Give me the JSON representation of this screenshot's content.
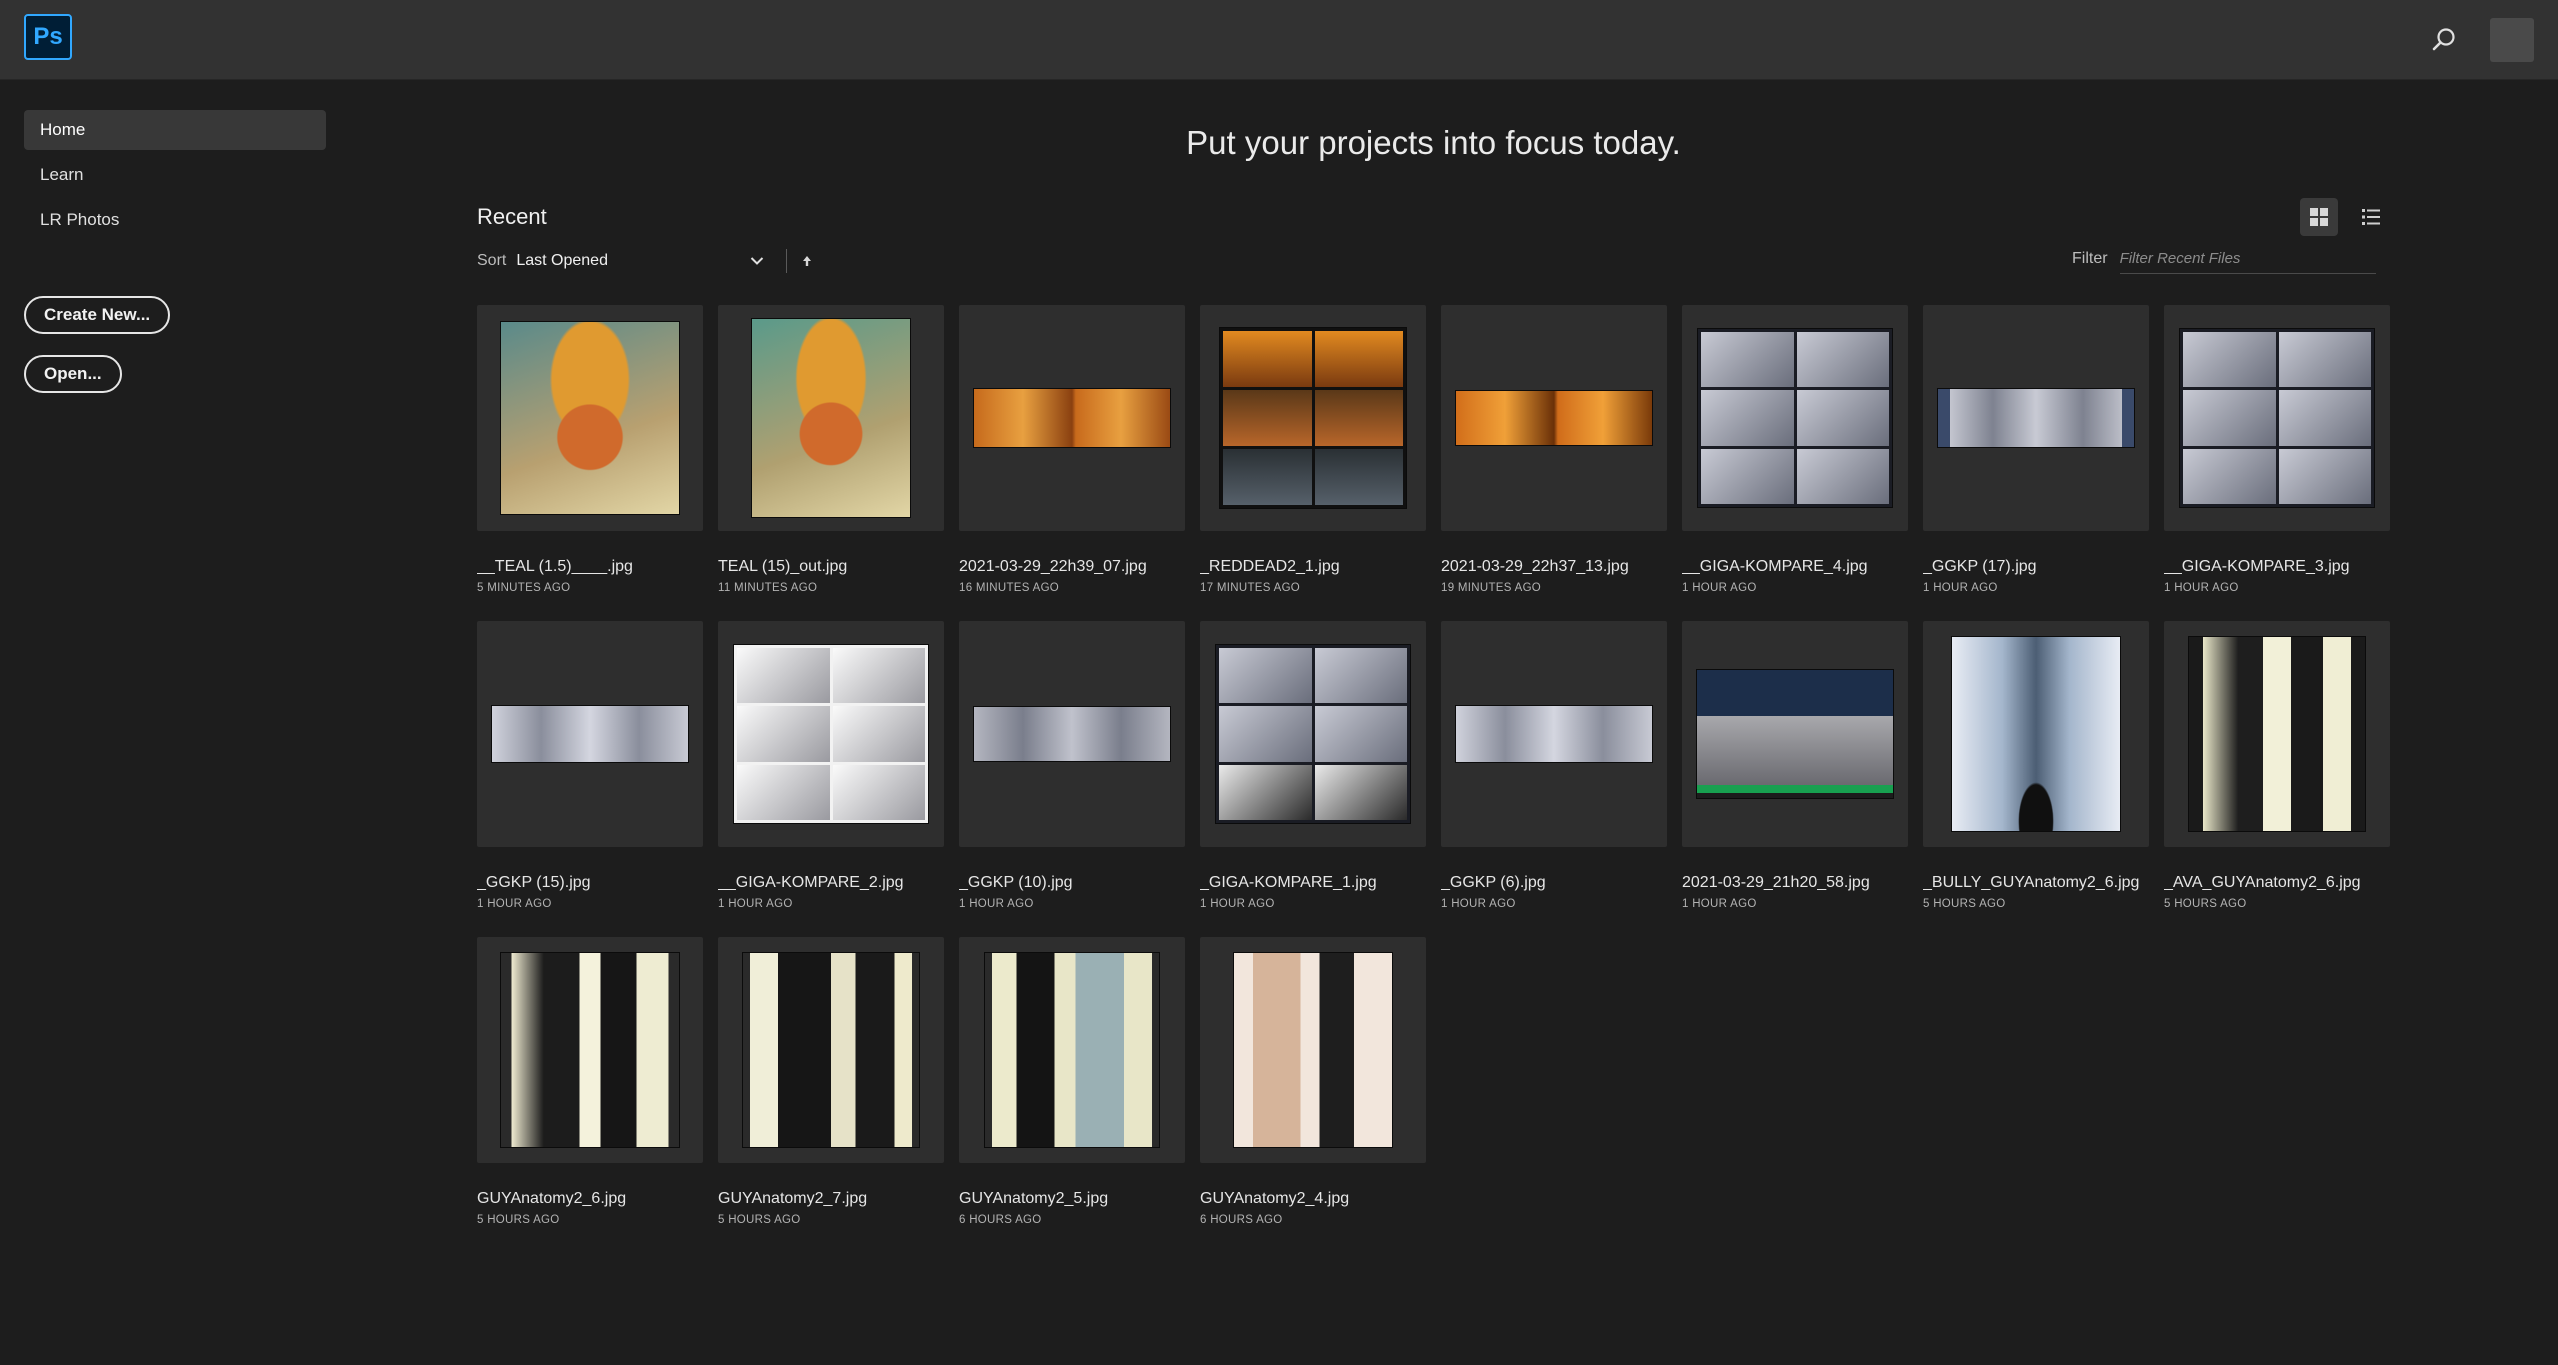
{
  "app": {
    "logo_text": "Ps",
    "brand_color": "#31a8ff"
  },
  "header": {
    "search_icon": "search-icon",
    "avatar_icon": "avatar"
  },
  "sidebar": {
    "items": [
      {
        "label": "Home",
        "active": true
      },
      {
        "label": "Learn",
        "active": false
      },
      {
        "label": "LR Photos",
        "active": false
      }
    ],
    "create_label": "Create New...",
    "open_label": "Open..."
  },
  "main": {
    "hero": "Put your projects into focus today.",
    "recent_title": "Recent",
    "sort_label": "Sort",
    "sort_value": "Last Opened",
    "filter_label": "Filter",
    "filter_placeholder": "Filter Recent Files",
    "view_mode": "grid"
  },
  "files": [
    {
      "name": "__TEAL (1.5)____.jpg",
      "time": "5 MINUTES AGO",
      "thumb": "portrait-orange"
    },
    {
      "name": "TEAL (15)_out.jpg",
      "time": "11 MINUTES AGO",
      "thumb": "portrait-orange2"
    },
    {
      "name": "2021-03-29_22h39_07.jpg",
      "time": "16 MINUTES AGO",
      "thumb": "wide-orange"
    },
    {
      "name": "_REDDEAD2_1.jpg",
      "time": "17 MINUTES AGO",
      "thumb": "collage-dark"
    },
    {
      "name": "2021-03-29_22h37_13.jpg",
      "time": "19 MINUTES AGO",
      "thumb": "wide-orange2"
    },
    {
      "name": "__GIGA-KOMPARE_4.jpg",
      "time": "1 HOUR AGO",
      "thumb": "collage-gray"
    },
    {
      "name": "_GGKP (17).jpg",
      "time": "1 HOUR AGO",
      "thumb": "wide-gray3"
    },
    {
      "name": "__GIGA-KOMPARE_3.jpg",
      "time": "1 HOUR AGO",
      "thumb": "collage-gray-light"
    },
    {
      "name": "_GGKP (15).jpg",
      "time": "1 HOUR AGO",
      "thumb": "wide-gray"
    },
    {
      "name": "__GIGA-KOMPARE_2.jpg",
      "time": "1 HOUR AGO",
      "thumb": "collage-white"
    },
    {
      "name": "_GGKP (10).jpg",
      "time": "1 HOUR AGO",
      "thumb": "wide-gray2"
    },
    {
      "name": "_GIGA-KOMPARE_1.jpg",
      "time": "1 HOUR AGO",
      "thumb": "collage-gray-dark"
    },
    {
      "name": "_GGKP (6).jpg",
      "time": "1 HOUR AGO",
      "thumb": "wide-gray"
    },
    {
      "name": "2021-03-29_21h20_58.jpg",
      "time": "1 HOUR AGO",
      "thumb": "ui-blue"
    },
    {
      "name": "_BULLY_GUYAnatomy2_6.jpg",
      "time": "5 HOURS AGO",
      "thumb": "neg-men"
    },
    {
      "name": "_AVA_GUYAnatomy2_6.jpg",
      "time": "5 HOURS AGO",
      "thumb": "men-cream"
    },
    {
      "name": "GUYAnatomy2_6.jpg",
      "time": "5 HOURS AGO",
      "thumb": "men-cream2"
    },
    {
      "name": "GUYAnatomy2_7.jpg",
      "time": "5 HOURS AGO",
      "thumb": "men-cream3"
    },
    {
      "name": "GUYAnatomy2_5.jpg",
      "time": "6 HOURS AGO",
      "thumb": "men-teal"
    },
    {
      "name": "GUYAnatomy2_4.jpg",
      "time": "6 HOURS AGO",
      "thumb": "men-beige"
    }
  ]
}
